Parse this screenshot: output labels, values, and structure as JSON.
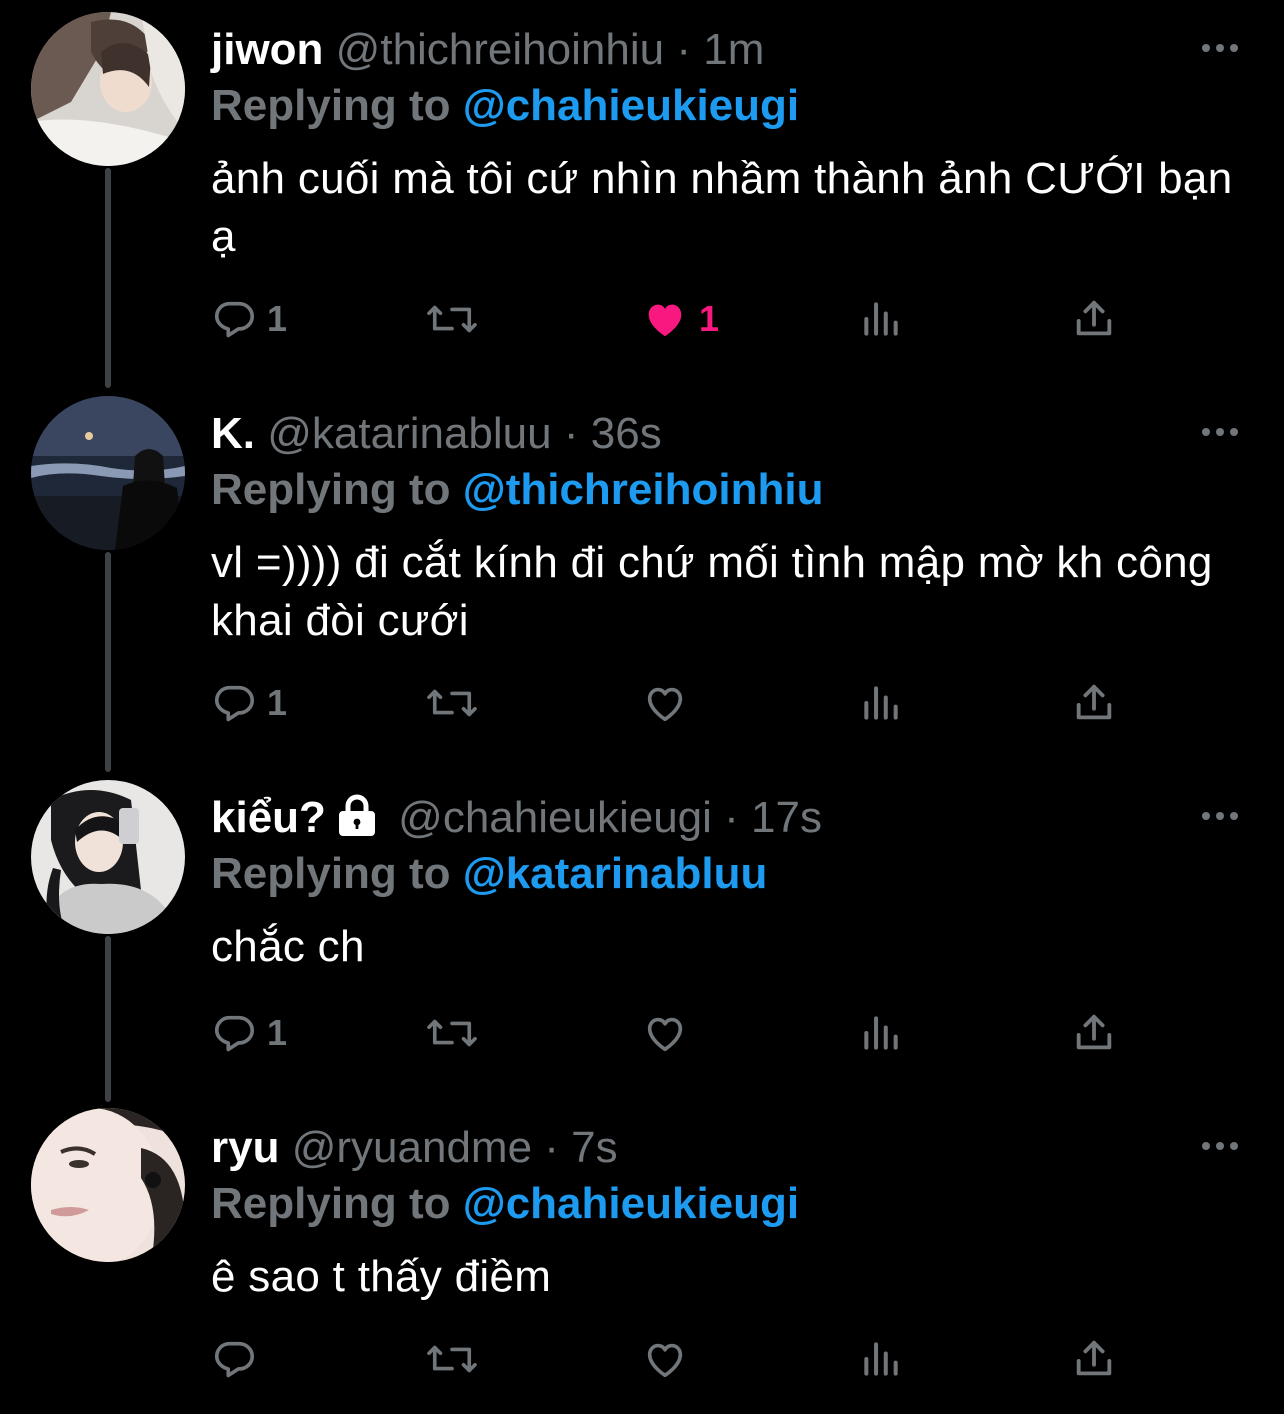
{
  "colors": {
    "background": "#000000",
    "text_primary": "#ffffff",
    "text_secondary": "#71767b",
    "accent": "#1d9bf0",
    "like_active": "#f91880",
    "thread_line": "#3d4146"
  },
  "tweets": [
    {
      "display_name": "jiwon",
      "handle": "@thichreihoinhiu",
      "separator": "·",
      "time": "1m",
      "reply_prefix": "Replying to",
      "reply_to": "@chahieukieugi",
      "text": "ảnh cuối mà tôi cứ nhìn nhầm thành ảnh CƯỚI bạn ạ",
      "reply_count": "1",
      "retweet_count": "",
      "like_count": "1",
      "liked": true
    },
    {
      "display_name": "K.",
      "handle": "@katarinabluu",
      "separator": "·",
      "time": "36s",
      "reply_prefix": "Replying to",
      "reply_to": "@thichreihoinhiu",
      "text": "vl =)))) đi cắt kính đi chứ mối tình mập mờ kh công khai đòi cưới",
      "reply_count": "1",
      "retweet_count": "",
      "like_count": "",
      "liked": false
    },
    {
      "display_name": "kiểu?",
      "protected": true,
      "handle": "@chahieukieugi",
      "separator": "·",
      "time": "17s",
      "reply_prefix": "Replying to",
      "reply_to": "@katarinabluu",
      "text": "chắc ch",
      "reply_count": "1",
      "retweet_count": "",
      "like_count": "",
      "liked": false
    },
    {
      "display_name": "ryu",
      "handle": "@ryuandme",
      "separator": "·",
      "time": "7s",
      "reply_prefix": "Replying to",
      "reply_to": "@chahieukieugi",
      "text": "ê sao t thấy điềm",
      "reply_count": "",
      "retweet_count": "",
      "like_count": "",
      "liked": false
    }
  ],
  "icons": {
    "more": "more-horizontal-icon",
    "reply": "reply-bubble-icon",
    "retweet": "retweet-icon",
    "like": "heart-icon",
    "views": "analytics-bars-icon",
    "share": "share-upload-icon",
    "protected": "lock-icon"
  }
}
